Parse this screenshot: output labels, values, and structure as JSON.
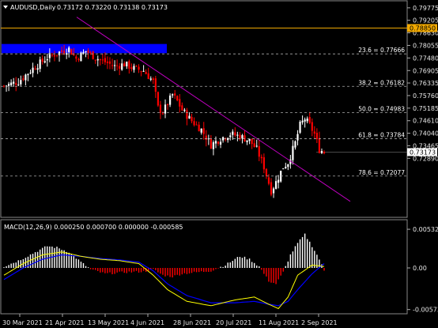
{
  "header": {
    "symbol_label": "AUDUSD,Daily",
    "ohlc": "0.73172 0.73220 0.73138 0.73173"
  },
  "price_axis": {
    "ticks": [
      "0.79775",
      "0.79205",
      "0.78630",
      "0.78055",
      "0.77480",
      "0.76905",
      "0.76335",
      "0.75760",
      "0.75185",
      "0.74610",
      "0.74040",
      "0.73465",
      "0.72890"
    ],
    "tag_top": "0.78850",
    "tag_current": "0.73173"
  },
  "fibonacci": [
    {
      "label": "23.6 = 0.77666",
      "value": 0.77666
    },
    {
      "label": "38.2 = 0.76182",
      "value": 0.76182
    },
    {
      "label": "50.0 = 0.74983",
      "value": 0.74983
    },
    {
      "label": "61.8 = 0.73784",
      "value": 0.73784
    },
    {
      "label": "78.6 = 0.72077",
      "value": 0.72077
    }
  ],
  "macd": {
    "label": "MACD(12,26,9) 0.000250 0.000700 0.000000 -0.000585",
    "ticks": [
      "0.00532",
      "0.00",
      "-0.00573"
    ]
  },
  "dates": [
    "30 Mar 2021",
    "21 Apr 2021",
    "13 May 2021",
    "4 Jun 2021",
    "28 Jun 2021",
    "20 Jul 2021",
    "11 Aug 2021",
    "2 Sep 2021"
  ],
  "colors": {
    "background": "#000000",
    "grid": "#5a5a5a",
    "bull": "#ffffff",
    "bear": "#ff0000",
    "trendline": "#c000c0",
    "box": "#0000ff",
    "resistance": "#f0a800",
    "macd_line": "#ffff00",
    "signal_line": "#0000ff",
    "hist_pos": "#ffffff",
    "hist_neg": "#ff0000"
  },
  "icons": {
    "dropdown": "triangle-down-icon"
  }
}
